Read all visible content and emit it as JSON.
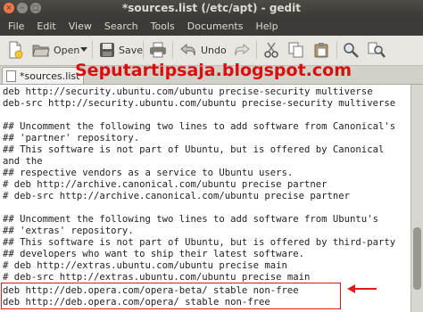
{
  "window": {
    "title": "*sources.list (/etc/apt) - gedit",
    "close_glyph": "×",
    "min_glyph": "–",
    "max_glyph": "□"
  },
  "menu": [
    "File",
    "Edit",
    "View",
    "Search",
    "Tools",
    "Documents",
    "Help"
  ],
  "toolbar": {
    "open_label": "Open",
    "save_label": "Save",
    "undo_label": "Undo"
  },
  "tab": {
    "label": "*sources.list"
  },
  "watermark": "Seputartipsaja.blogspot.com",
  "editor": {
    "lines": [
      "deb http://security.ubuntu.com/ubuntu precise-security multiverse",
      "deb-src http://security.ubuntu.com/ubuntu precise-security multiverse",
      "",
      "## Uncomment the following two lines to add software from Canonical's",
      "## 'partner' repository.",
      "## This software is not part of Ubuntu, but is offered by Canonical",
      "and the",
      "## respective vendors as a service to Ubuntu users.",
      "# deb http://archive.canonical.com/ubuntu precise partner",
      "# deb-src http://archive.canonical.com/ubuntu precise partner",
      "",
      "## Uncomment the following two lines to add software from Ubuntu's",
      "## 'extras' repository.",
      "## This software is not part of Ubuntu, but is offered by third-party",
      "## developers who want to ship their latest software.",
      "# deb http://extras.ubuntu.com/ubuntu precise main",
      "# deb-src http://extras.ubuntu.com/ubuntu precise main",
      "deb http://deb.opera.com/opera-beta/ stable non-free",
      "deb http://deb.opera.com/opera/ stable non-free"
    ]
  },
  "colors": {
    "highlight": "#e01b1b",
    "watermark": "#d80f0f"
  }
}
